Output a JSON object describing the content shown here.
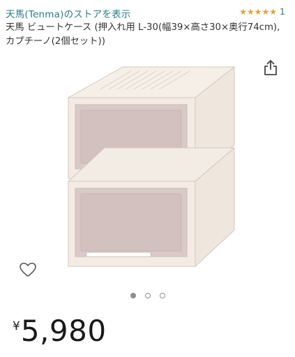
{
  "store": {
    "link_text": "天馬(Tenma)のストアを表示"
  },
  "rating": {
    "stars": 5,
    "count": "1",
    "color": "#e7a02e"
  },
  "product": {
    "title": "天馬 ビュートケース (押入れ用 L-30(幅39×高さ30×奥行74cm), カプチーノ(2個セット))",
    "image_icon": "stacked-storage-drawers-image"
  },
  "actions": {
    "share_icon": "share-icon",
    "favorite_icon": "heart-icon"
  },
  "carousel": {
    "total": 3,
    "active_index": 0
  },
  "price": {
    "symbol": "¥",
    "value": "5,980"
  },
  "colors": {
    "link": "#2a7d84",
    "star": "#e7a02e",
    "dot": "#8a8f94"
  }
}
